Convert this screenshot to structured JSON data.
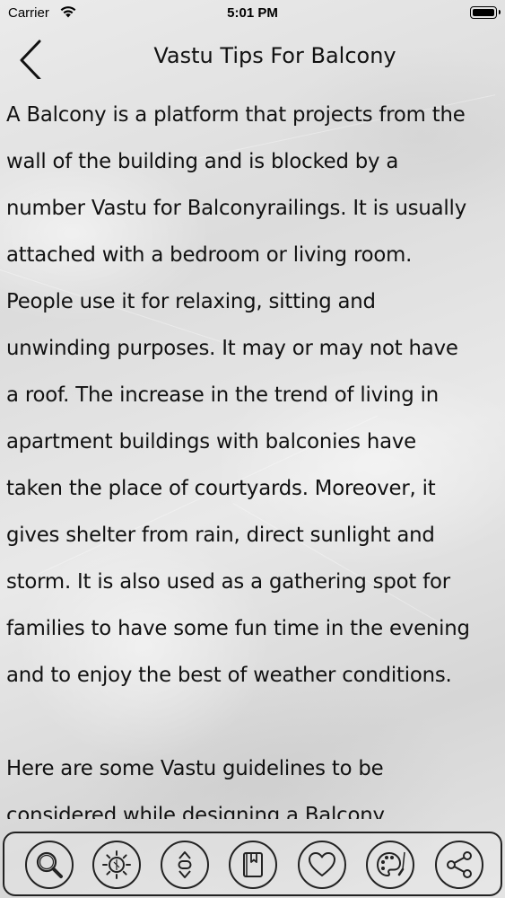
{
  "status_bar": {
    "carrier": "Carrier",
    "time": "5:01 PM"
  },
  "nav": {
    "title": "Vastu Tips For Balcony"
  },
  "content": {
    "paragraphs": [
      "A Balcony is a platform that projects from the\nwall of the building and is blocked by a\nnumber Vastu for Balconyrailings. It is usually\nattached with a bedroom or living room.\nPeople use it for relaxing, sitting and\nunwinding purposes. It may or may not have\na roof. The increase in the trend of living in\napartment buildings with balconies have\ntaken the place of courtyards. Moreover, it\ngives shelter from rain, direct sunlight and\nstorm. It is also used as a gathering spot for\nfamilies to have some fun time in the evening\nand to enjoy the best of weather conditions.",
      "Here are some Vastu guidelines to be\nconsidered while designing a Balcony"
    ]
  },
  "toolbar": {
    "icons": [
      "search-icon",
      "brightness-icon",
      "font-size-icon",
      "bookmark-book-icon",
      "heart-icon",
      "palette-icon",
      "share-icon"
    ]
  }
}
